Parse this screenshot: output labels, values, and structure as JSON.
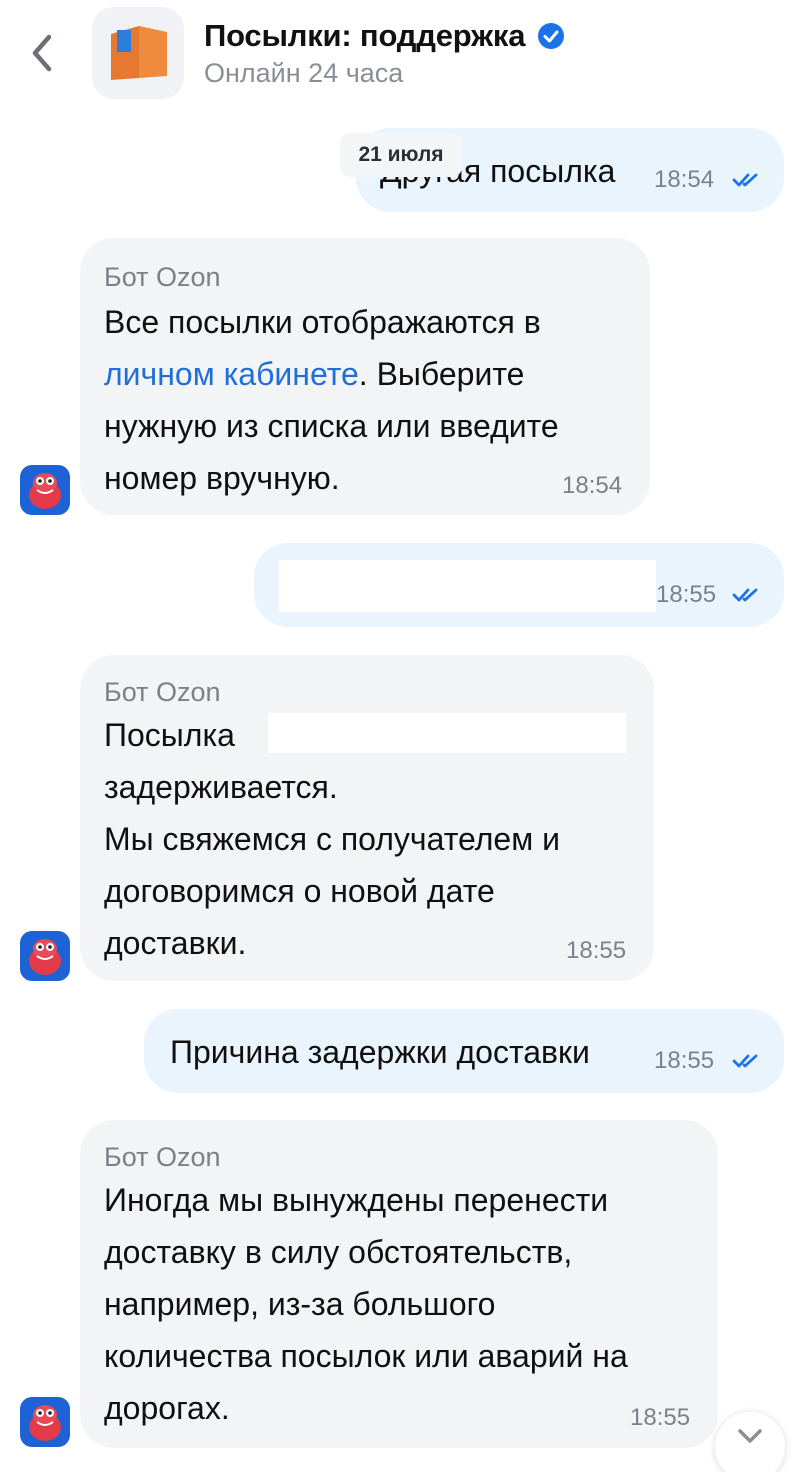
{
  "header": {
    "title": "Посылки: поддержка",
    "status": "Онлайн 24 часа",
    "back_icon": "chevron-left-icon",
    "verified_icon": "verified-badge-icon",
    "logo_icon": "parcel-box-icon"
  },
  "date_chip": "21 июля",
  "messages": [
    {
      "direction": "outgoing",
      "text": "Другая посылка",
      "time": "18:54",
      "status": "read"
    },
    {
      "direction": "incoming",
      "sender": "Бот Ozon",
      "lines": [
        "Все посылки отображаются в",
        "личном кабинете",
        ". Выберите",
        "нужную из списка или введите",
        "номер вручную."
      ],
      "time": "18:54"
    },
    {
      "direction": "outgoing",
      "text": "",
      "time": "18:55",
      "status": "read"
    },
    {
      "direction": "incoming",
      "sender": "Бот Ozon",
      "lines": [
        "Посылка",
        "задерживается.",
        "Мы свяжемся с получателем и",
        "договоримся о новой дате",
        "доставки."
      ],
      "time": "18:55"
    },
    {
      "direction": "outgoing",
      "text": "Причина задержки доставки",
      "time": "18:55",
      "status": "read"
    },
    {
      "direction": "incoming",
      "sender": "Бот Ozon",
      "lines": [
        "Иногда мы вынуждены перенести",
        "доставку в силу обстоятельств,",
        "например, из-за большого",
        "количества посылок или аварий на",
        "дорогах."
      ],
      "time": "18:55"
    }
  ],
  "scroll_down_icon": "chevron-down-icon",
  "colors": {
    "outgoing_bubble": "#eaf4fc",
    "incoming_bubble": "#f3f4f6",
    "link": "#1f6fd8",
    "verified": "#1a73e8",
    "check": "#1a73e8"
  }
}
